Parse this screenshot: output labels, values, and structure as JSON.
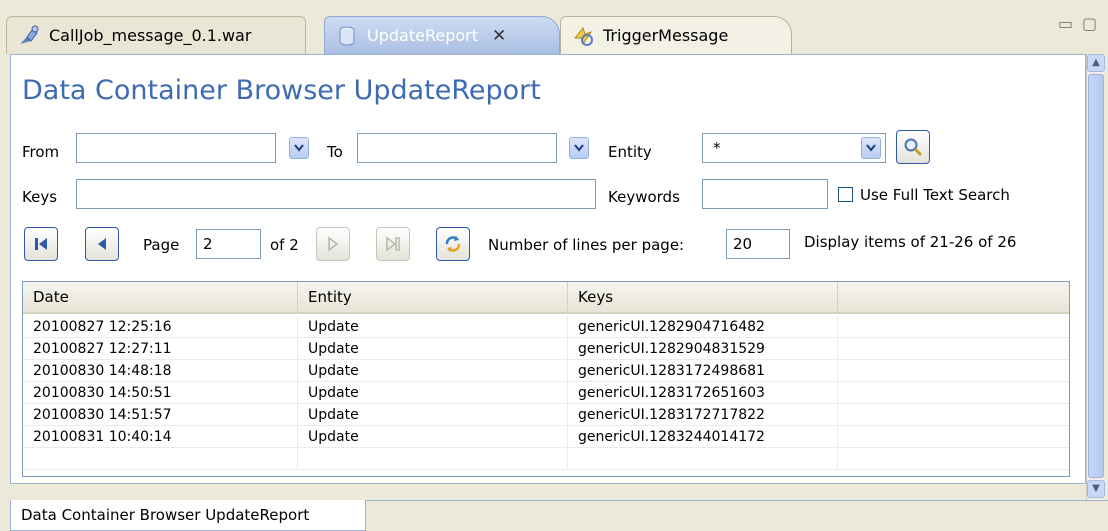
{
  "tabs": [
    {
      "label": "CallJob_message_0.1.war",
      "icon": "war-file-icon"
    },
    {
      "label": "UpdateReport",
      "icon": "data-container-icon",
      "active": true,
      "close": "✕"
    },
    {
      "label": "TriggerMessage",
      "icon": "trigger-icon"
    }
  ],
  "window_controls": {
    "minimize": "▭",
    "maximize": "▢"
  },
  "title": "Data Container Browser UpdateReport",
  "filters": {
    "from_label": "From",
    "from_value": "",
    "to_label": "To",
    "to_value": "",
    "entity_label": "Entity",
    "entity_value": "*",
    "keys_label": "Keys",
    "keys_value": "",
    "keywords_label": "Keywords",
    "keywords_value": "",
    "fulltext_label": "Use Full Text Search",
    "fulltext_checked": false
  },
  "paging": {
    "page_label": "Page",
    "page_value": "2",
    "of_label": "of 2",
    "lines_label": "Number of lines per page:",
    "lines_value": "20",
    "display_text": "Display items of 21-26 of 26"
  },
  "table": {
    "columns": [
      "Date",
      "Entity",
      "Keys",
      ""
    ],
    "rows": [
      [
        "20100827 12:25:16",
        "Update",
        "genericUI.1282904716482",
        ""
      ],
      [
        "20100827 12:27:11",
        "Update",
        "genericUI.1282904831529",
        ""
      ],
      [
        "20100830 14:48:18",
        "Update",
        "genericUI.1283172498681",
        ""
      ],
      [
        "20100830 14:50:51",
        "Update",
        "genericUI.1283172651603",
        ""
      ],
      [
        "20100830 14:51:57",
        "Update",
        "genericUI.1283172717822",
        ""
      ],
      [
        "20100831 10:40:14",
        "Update",
        "genericUI.1283244014172",
        ""
      ],
      [
        "",
        "",
        "",
        ""
      ]
    ]
  },
  "bottom_tab": "Data Container Browser UpdateReport",
  "colors": {
    "title": "#3d6bb4",
    "accent": "#2e5aa7"
  }
}
